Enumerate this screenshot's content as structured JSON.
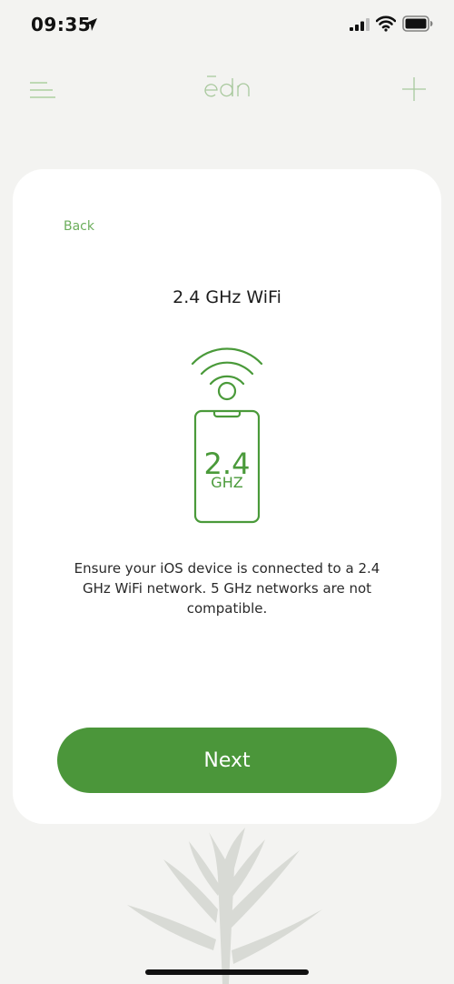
{
  "status_bar": {
    "time": "09:35"
  },
  "nav": {
    "logo_text": "ēdn"
  },
  "card": {
    "back_label": "Back",
    "title": "2.4 GHz WiFi",
    "illustration": {
      "freq_value": "2.4",
      "freq_unit": "GHZ"
    },
    "description": "Ensure your iOS device is connected to a 2.4 GHz WiFi network. 5 GHz networks are not compatible.",
    "next_label": "Next"
  },
  "colors": {
    "accent": "#4b963a",
    "accent_light": "#6cae5c",
    "background": "#f3f3f1",
    "card": "#ffffff"
  }
}
